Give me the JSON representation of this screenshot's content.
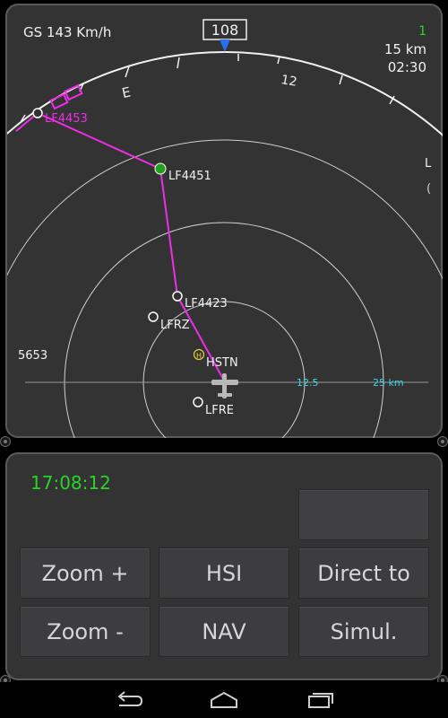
{
  "map": {
    "ground_speed": "GS 143 Km/h",
    "heading": "108",
    "top_right_count": "1",
    "range": "15 km",
    "time_remaining": "02:30",
    "compass_labels": [
      "E",
      "12"
    ],
    "ring_labels": [
      "12.5",
      "25 km"
    ],
    "left_edge_label": "5653",
    "right_edge_label": "L",
    "waypoints": [
      "LF4453",
      "LF4451",
      "LF4423",
      "LFRZ",
      "HSTN",
      "LFRE"
    ],
    "heliport_symbol": "H",
    "colors": {
      "route": "#ee2de6",
      "active_waypoint": "#1ea01e",
      "ring_label": "#3ad3e8",
      "heading_marker": "#2a6ef0",
      "heliport": "#e8d23a"
    }
  },
  "control": {
    "clock": "17:08:12",
    "buttons": {
      "zoom_in": "Zoom +",
      "hsi": "HSI",
      "direct_to": "Direct to",
      "zoom_out": "Zoom -",
      "nav": "NAV",
      "simul": "Simul."
    },
    "clock_color": "#27d427"
  },
  "navbar": {
    "back": "back-icon",
    "home": "home-icon",
    "recents": "recents-icon"
  }
}
